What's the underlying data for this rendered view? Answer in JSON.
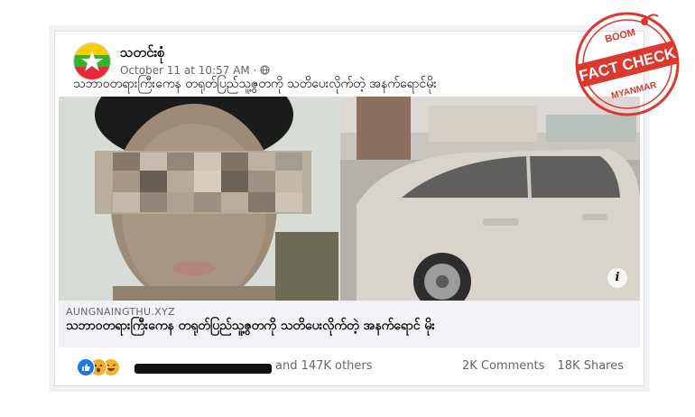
{
  "post": {
    "author": "သတင်းစုံ",
    "timestamp": "October 11 at 10:57 AM · ",
    "globe_icon": "globe-icon",
    "caption": "သဘာဝတရားကြီးကေန တရုတ်ပြည်သူ့ဇွတကို သတိပေးလိုက်တဲ့ အနက်ရောင်မိုး"
  },
  "link_preview": {
    "domain": "AUNGNAINGTHU.XYZ",
    "title": "သဘာဝတရားကြီးကေန တရုတ်ပြည်သူ့ဇွတကို သတိပေးလိုက်တဲ့ အနက်ရောင် မိုး",
    "info_icon": "info-icon",
    "info_glyph": "i"
  },
  "engagement": {
    "reaction_icons": [
      "like-icon",
      "wow-icon",
      "haha-icon"
    ],
    "others": "and 147K others",
    "comments": "2K Comments",
    "shares": "18K Shares"
  },
  "stamp": {
    "top": "BOOM",
    "main": "FACT CHECK",
    "bottom": "MYANMAR"
  },
  "colors": {
    "stamp_red": "#e0362b",
    "like_blue": "#1877f2",
    "reaction_yellow": "#f7b125"
  }
}
